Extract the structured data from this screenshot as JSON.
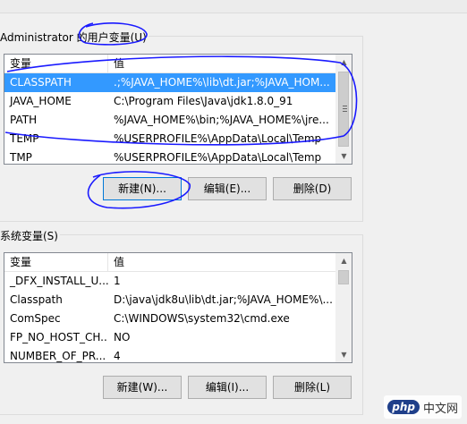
{
  "user_vars": {
    "title": "Administrator 的用户变量(U)",
    "columns": [
      "变量",
      "值"
    ],
    "rows": [
      {
        "name": "CLASSPATH",
        "value": ".;%JAVA_HOME%\\lib\\dt.jar;%JAVA_HOM...",
        "selected": true
      },
      {
        "name": "JAVA_HOME",
        "value": "C:\\Program Files\\Java\\jdk1.8.0_91",
        "selected": false
      },
      {
        "name": "PATH",
        "value": "%JAVA_HOME%\\bin;%JAVA_HOME%\\jre...",
        "selected": false
      },
      {
        "name": "TEMP",
        "value": "%USERPROFILE%\\AppData\\Local\\Temp",
        "selected": false
      },
      {
        "name": "TMP",
        "value": "%USERPROFILE%\\AppData\\Local\\Temp",
        "selected": false
      }
    ],
    "buttons": {
      "new": "新建(N)...",
      "edit": "编辑(E)...",
      "delete": "删除(D)"
    }
  },
  "system_vars": {
    "title": "系统变量(S)",
    "columns": [
      "变量",
      "值"
    ],
    "rows": [
      {
        "name": "_DFX_INSTALL_U...",
        "value": "1",
        "selected": false
      },
      {
        "name": "Classpath",
        "value": "D:\\java\\jdk8u\\lib\\dt.jar;%JAVA_HOME%\\...",
        "selected": false
      },
      {
        "name": "ComSpec",
        "value": "C:\\WINDOWS\\system32\\cmd.exe",
        "selected": false
      },
      {
        "name": "FP_NO_HOST_CH...",
        "value": "NO",
        "selected": false
      },
      {
        "name": "NUMBER_OF_PR...",
        "value": "4",
        "selected": false
      }
    ],
    "buttons": {
      "new": "新建(W)...",
      "edit": "编辑(I)...",
      "delete": "删除(L)"
    }
  },
  "watermark": {
    "logo": "php",
    "text": "中文网"
  },
  "colors": {
    "selection": "#3399ff",
    "annotation": "#1a1aff"
  }
}
